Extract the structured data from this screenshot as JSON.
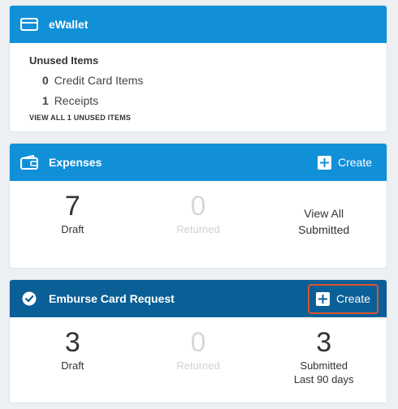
{
  "ewallet": {
    "title": "eWallet",
    "unused_title": "Unused Items",
    "credit_count": "0",
    "credit_label": "Credit Card Items",
    "receipts_count": "1",
    "receipts_label": "Receipts",
    "view_all_link": "VIEW ALL 1 UNUSED ITEMS"
  },
  "expenses": {
    "title": "Expenses",
    "create_label": "Create",
    "draft_count": "7",
    "draft_label": "Draft",
    "returned_count": "0",
    "returned_label": "Returned",
    "view_all_line1": "View All",
    "view_all_line2": "Submitted"
  },
  "card_request": {
    "title": "Emburse Card Request",
    "create_label": "Create",
    "draft_count": "3",
    "draft_label": "Draft",
    "returned_count": "0",
    "returned_label": "Returned",
    "submitted_count": "3",
    "submitted_label": "Submitted",
    "submitted_sub": "Last 90 days"
  },
  "colors": {
    "header_blue": "#1190d8",
    "header_navy": "#0a5f96",
    "highlight": "#e0532b"
  }
}
